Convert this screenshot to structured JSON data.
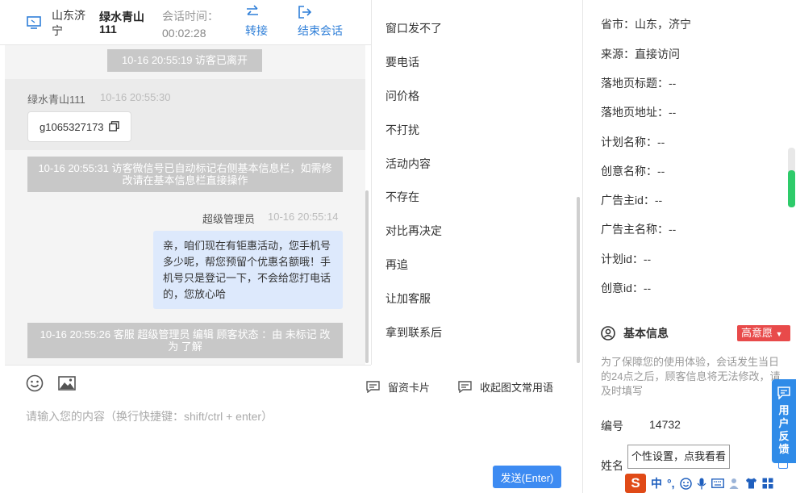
{
  "header": {
    "location": "山东济宁",
    "visitor_name": "绿水青山111",
    "time_label": "会话时间：",
    "duration": "00:02:28",
    "transfer_label": "转接",
    "end_label": "结束会话"
  },
  "messages": {
    "sys_left": "10-16 20:55:19 访客已离开",
    "visitor_name": "绿水青山111",
    "visitor_time": "10-16 20:55:30",
    "visitor_text": "g1065327173",
    "sys_wechat": "10-16 20:55:31 访客微信号已自动标记右侧基本信息栏，如需修改请在基本信息栏直接操作",
    "agent_name": "超级管理员",
    "agent_time": "10-16 20:55:14",
    "agent_text": "亲，咱们现在有钜惠活动，您手机号多少呢，帮您预留个优惠名额哦！手机号只是登记一下，不会给您打电话的，您放心哈",
    "sys_status": "10-16 20:55:26 客服 超级管理员 编辑 顾客状态 ：由 未标记 改为 了解"
  },
  "composer": {
    "card_label": "留资卡片",
    "collapse_label": "收起图文常用语",
    "placeholder": "请输入您的内容（换行快捷键：shift/ctrl + enter）",
    "send_label": "发送(Enter)"
  },
  "quick_replies": [
    "窗口发不了",
    "要电话",
    "问价格",
    "不打扰",
    "活动内容",
    "不存在",
    "对比再决定",
    "再追",
    "让加客服",
    "拿到联系后"
  ],
  "info": {
    "rows": [
      "省市：山东，济宁",
      "来源：直接访问",
      "落地页标题：--",
      "落地页地址：--",
      "计划名称：--",
      "创意名称：--",
      "广告主id：--",
      "广告主名称：--",
      "计划id：--",
      "创意id：--"
    ],
    "basic_title": "基本信息",
    "intent": "高意愿",
    "notice": "为了保障您的使用体验，会话发生当日的24点之后，顾客信息将无法修改，请及时填写",
    "number_label": "编号",
    "number_value": "14732",
    "name_label": "姓名"
  },
  "tooltip": "个性设置，点我看看",
  "feedback": "用户反馈",
  "ime": {
    "logo": "S",
    "lang": "中",
    "punct": "°,"
  },
  "colors": {
    "accent": "#3d8bf2",
    "badge": "#e84a4a",
    "agent_bubble": "#dde9fc",
    "system_pill": "#c8c8c8"
  }
}
